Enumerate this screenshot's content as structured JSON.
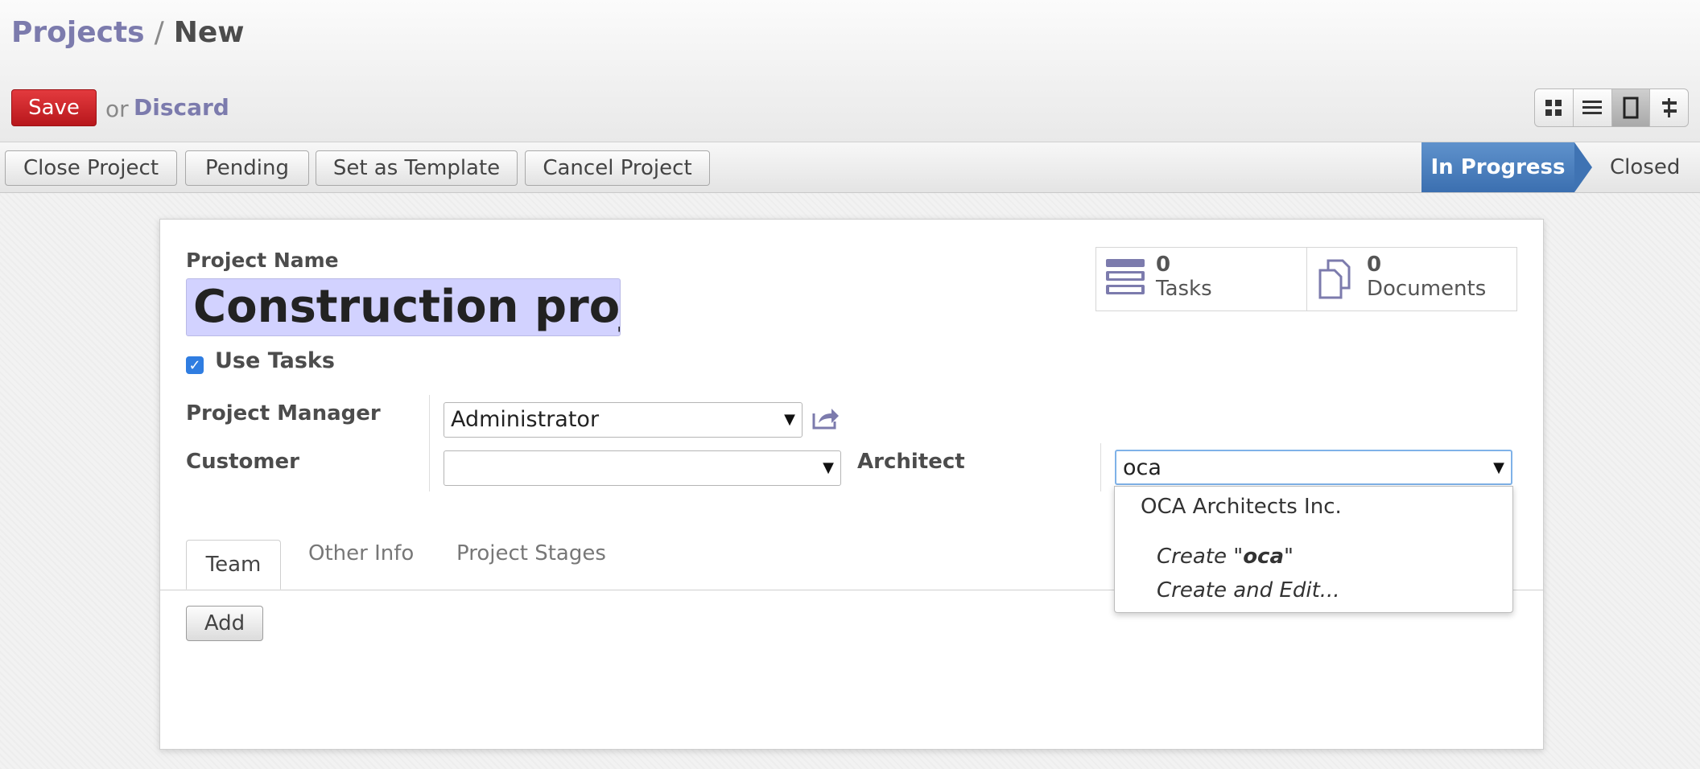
{
  "breadcrumb": {
    "root": "Projects",
    "separator": "/",
    "current": "New"
  },
  "toolbar": {
    "save_label": "Save",
    "or_text": "or",
    "discard_label": "Discard"
  },
  "view_switcher": [
    "kanban-view-icon",
    "list-view-icon",
    "form-view-icon",
    "gantt-view-icon"
  ],
  "actions": [
    "Close Project",
    "Pending",
    "Set as Template",
    "Cancel Project"
  ],
  "stages": {
    "active": "In Progress",
    "next": "Closed"
  },
  "form": {
    "name_label": "Project Name",
    "name_value": "Construction proje",
    "use_tasks_label": "Use Tasks",
    "use_tasks_checked": true,
    "manager_label": "Project Manager",
    "manager_value": "Administrator",
    "customer_label": "Customer",
    "customer_value": "",
    "architect_label": "Architect",
    "architect_value": "oca"
  },
  "stats": [
    {
      "count": "0",
      "label": "Tasks",
      "icon": "tasks-icon"
    },
    {
      "count": "0",
      "label": "Documents",
      "icon": "documents-icon"
    }
  ],
  "tabs": [
    "Team",
    "Other Info",
    "Project Stages"
  ],
  "team": {
    "add_label": "Add"
  },
  "autocomplete": {
    "result": "OCA Architects Inc.",
    "create_prefix": "Create \"",
    "create_term": "oca",
    "create_suffix": "\"",
    "create_edit": "Create and Edit..."
  },
  "colors": {
    "accent": "#7c7bad",
    "save": "#c9262b",
    "stage_active": "#3b6fb0",
    "name_bg": "#d2d2ff",
    "checkbox": "#2f7de1"
  }
}
